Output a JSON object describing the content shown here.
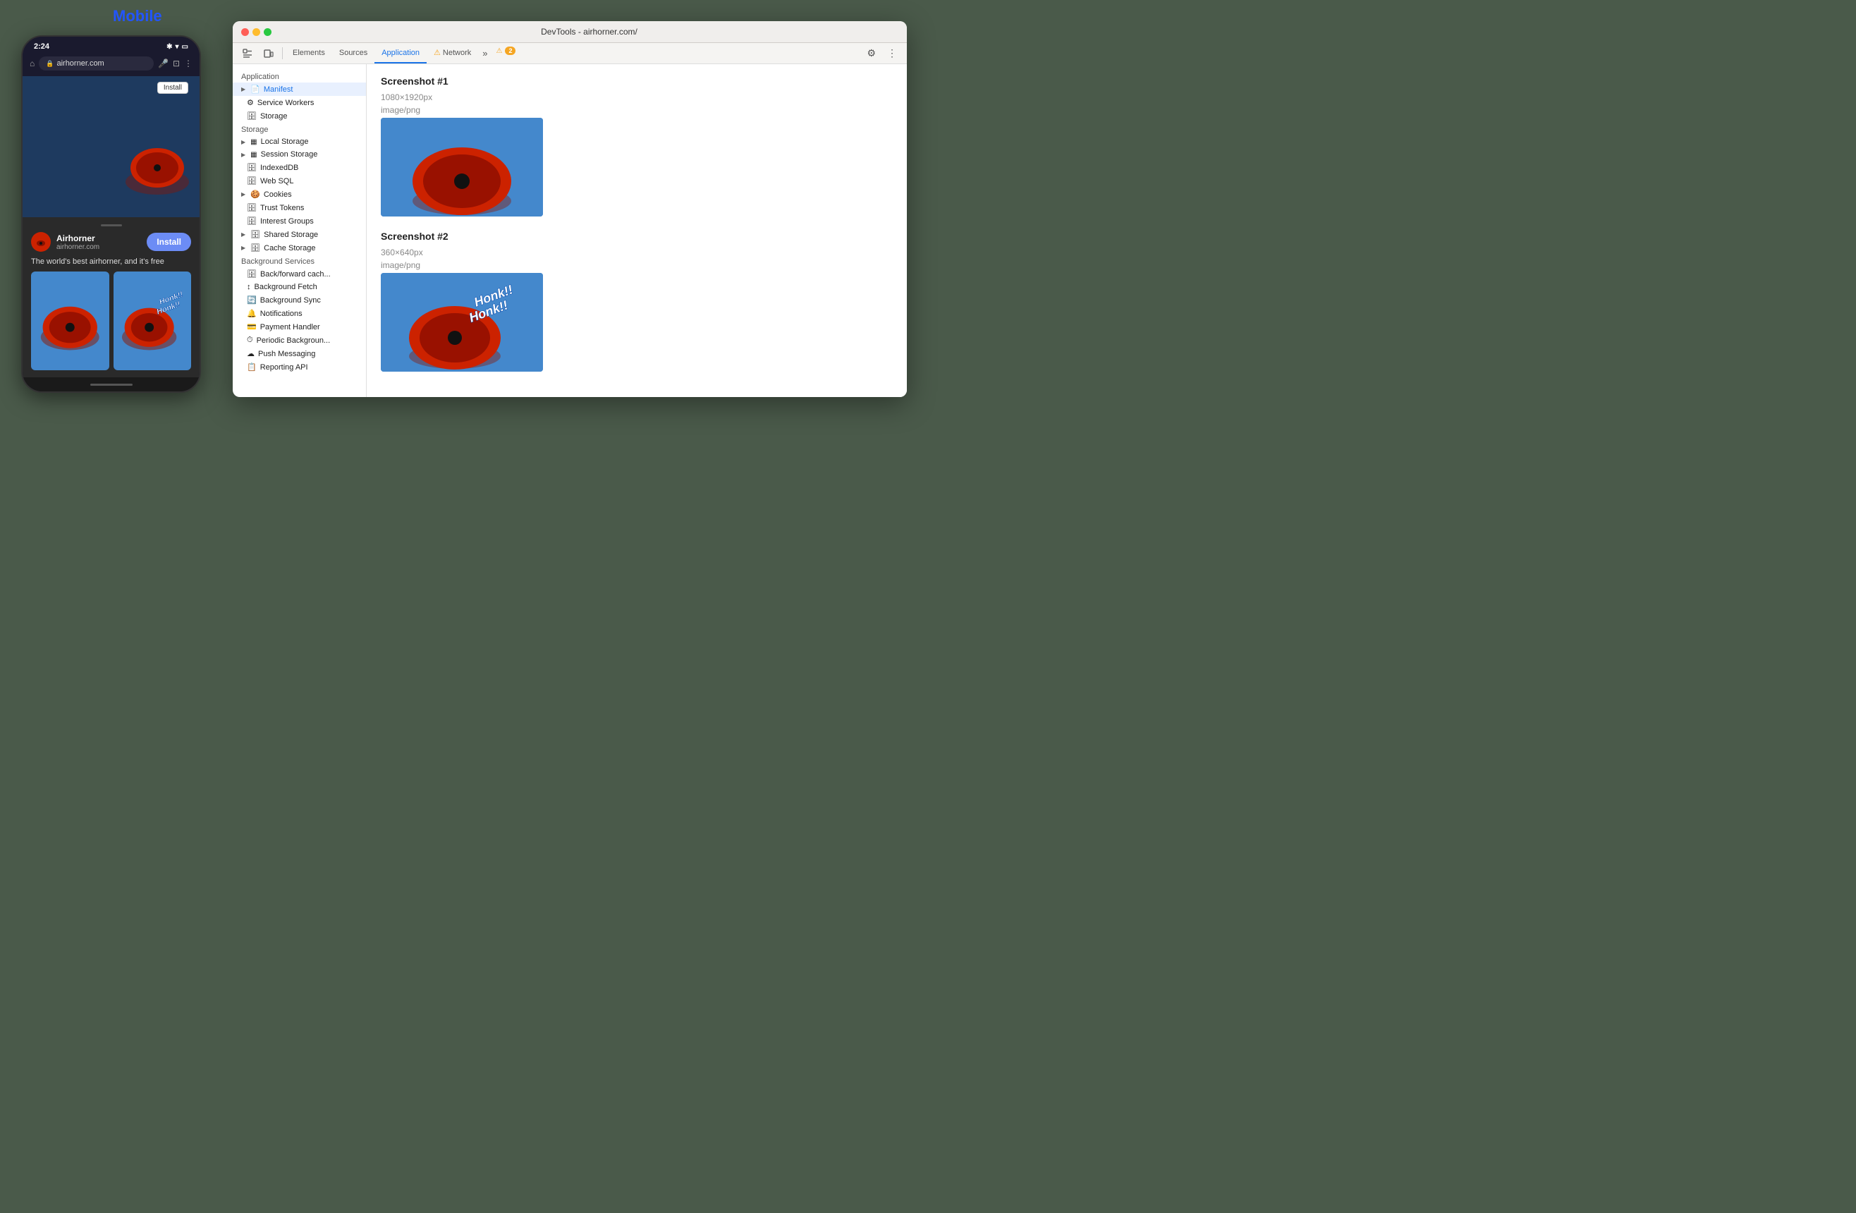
{
  "mobile": {
    "label": "Mobile",
    "time": "2:24",
    "url": "airhorner.com",
    "install_top_label": "Install",
    "app_name": "Airhorner",
    "app_url": "airhorner.com",
    "install_btn_label": "Install",
    "app_desc": "The world's best airhorner, and it's free"
  },
  "devtools": {
    "title": "DevTools - airhorner.com/",
    "tabs": [
      {
        "label": "Elements",
        "active": false
      },
      {
        "label": "Sources",
        "active": false
      },
      {
        "label": "Application",
        "active": true
      },
      {
        "label": "Network",
        "active": false
      }
    ],
    "warning_count": "2",
    "sidebar": {
      "sections": [
        {
          "header": "Application",
          "items": [
            {
              "label": "Manifest",
              "icon": "📄",
              "expandable": true,
              "active": true
            },
            {
              "label": "Service Workers",
              "icon": "⚙️"
            },
            {
              "label": "Storage",
              "icon": "🗄️"
            }
          ]
        },
        {
          "header": "Storage",
          "items": [
            {
              "label": "Local Storage",
              "icon": "▦",
              "expandable": true
            },
            {
              "label": "Session Storage",
              "icon": "▦",
              "expandable": true
            },
            {
              "label": "IndexedDB",
              "icon": "🗄️"
            },
            {
              "label": "Web SQL",
              "icon": "🗄️"
            },
            {
              "label": "Cookies",
              "icon": "🍪",
              "expandable": true
            },
            {
              "label": "Trust Tokens",
              "icon": "🗄️"
            },
            {
              "label": "Interest Groups",
              "icon": "🗄️"
            },
            {
              "label": "Shared Storage",
              "icon": "🗄️",
              "expandable": true
            },
            {
              "label": "Cache Storage",
              "icon": "🗄️",
              "expandable": true
            }
          ]
        },
        {
          "header": "Background Services",
          "items": [
            {
              "label": "Back/forward cache",
              "icon": "🗄️"
            },
            {
              "label": "Background Fetch",
              "icon": "↕️"
            },
            {
              "label": "Background Sync",
              "icon": "🔄"
            },
            {
              "label": "Notifications",
              "icon": "🔔"
            },
            {
              "label": "Payment Handler",
              "icon": "💳"
            },
            {
              "label": "Periodic Background...",
              "icon": "⏱️"
            },
            {
              "label": "Push Messaging",
              "icon": "☁️"
            },
            {
              "label": "Reporting API",
              "icon": "📋"
            }
          ]
        }
      ]
    },
    "screenshots": [
      {
        "title": "Screenshot #1",
        "size": "1080×1920px",
        "type": "image/png",
        "has_honk": false
      },
      {
        "title": "Screenshot #2",
        "size": "360×640px",
        "type": "image/png",
        "has_honk": true
      }
    ]
  }
}
